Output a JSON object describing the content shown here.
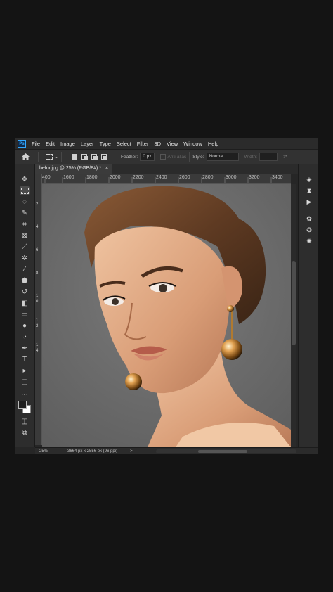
{
  "menubar": {
    "logo": "Ps",
    "items": [
      "File",
      "Edit",
      "Image",
      "Layer",
      "Type",
      "Select",
      "Filter",
      "3D",
      "View",
      "Window",
      "Help"
    ]
  },
  "options": {
    "feather_label": "Feather:",
    "feather_value": "0 px",
    "anti_alias_label": "Anti-alias",
    "style_label": "Style:",
    "style_value": "Normal",
    "width_label": "Width:"
  },
  "document": {
    "tab_title": "befor.jpg @ 25% (RGB/8#) *",
    "close_glyph": "×"
  },
  "ruler": {
    "top_ticks": [
      "400",
      "1600",
      "1800",
      "2000",
      "2200",
      "2400",
      "2600",
      "2800",
      "3000",
      "3200",
      "3400"
    ],
    "left_ticks": [
      "2",
      "4",
      "6",
      "8",
      "1",
      "0",
      "1",
      "2",
      "1",
      "4"
    ]
  },
  "status": {
    "zoom": "25%",
    "dimensions": "3664 px x 2556 px (96 ppi)",
    "arrow": ">"
  },
  "colors": {
    "accent": "#31a8ff",
    "foreground_swatch": "#1e1e1e",
    "background_swatch": "#ffffff"
  },
  "icons": {
    "tools": [
      "move-icon",
      "rectangular-marquee-icon",
      "lasso-icon",
      "quick-selection-icon",
      "crop-icon",
      "frame-icon",
      "eyedropper-icon",
      "spot-healing-icon",
      "brush-icon",
      "clone-stamp-icon",
      "history-brush-icon",
      "eraser-icon",
      "gradient-icon",
      "blur-icon",
      "dodge-icon",
      "pen-icon",
      "type-icon",
      "path-selection-icon",
      "rectangle-icon",
      "more-tools-icon",
      "quick-mask-icon",
      "screen-mode-icon"
    ],
    "panels": [
      "layers-icon",
      "history-icon",
      "actions-icon",
      "adjustments-icon",
      "styles-icon",
      "brush-settings-icon"
    ]
  }
}
